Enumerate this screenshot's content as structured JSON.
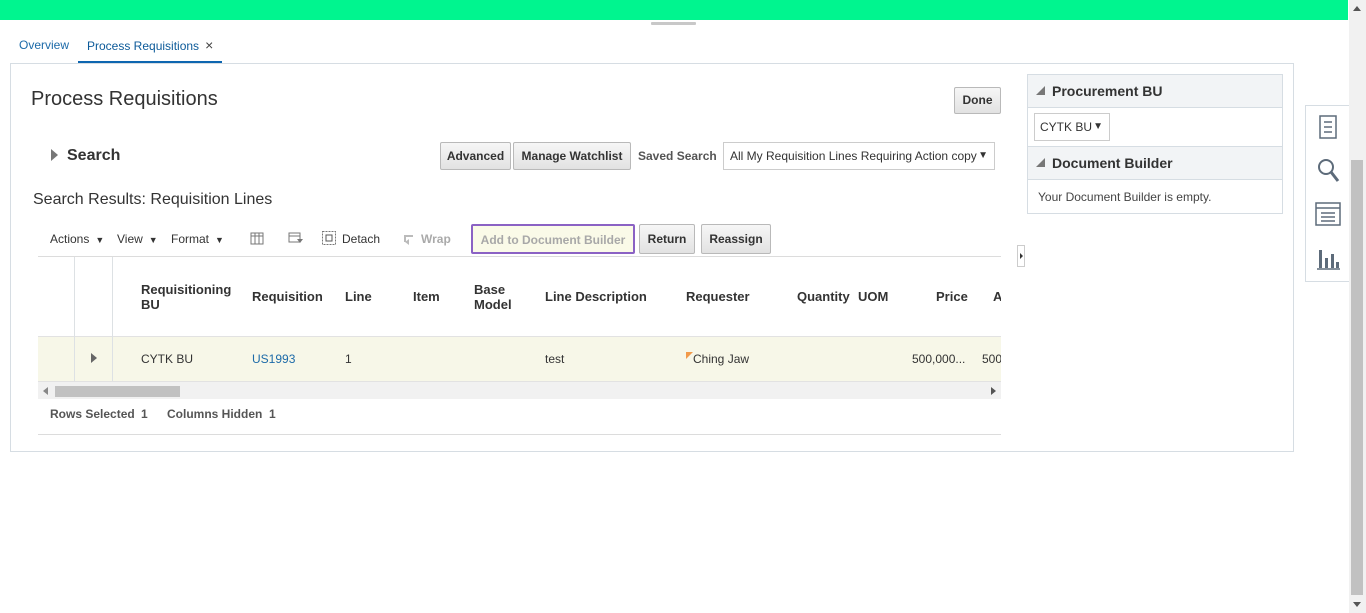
{
  "tabs": {
    "overview": "Overview",
    "active": "Process Requisitions",
    "close": "×"
  },
  "page": {
    "title": "Process Requisitions",
    "done_label": "Done"
  },
  "search": {
    "label": "Search",
    "advanced_label": "Advanced",
    "manage_watchlist_label": "Manage Watchlist",
    "saved_search_label": "Saved Search",
    "saved_search_value": "All My Requisition Lines Requiring Action copy"
  },
  "results": {
    "title": "Search Results: Requisition Lines",
    "toolbar": {
      "actions": "Actions",
      "view": "View",
      "format": "Format",
      "detach": "Detach",
      "wrap": "Wrap",
      "add_to_document_builder": "Add to Document Builder",
      "return": "Return",
      "reassign": "Reassign"
    },
    "columns": [
      "Requisitioning BU",
      "Requisition",
      "Line",
      "Item",
      "Base Model",
      "Line Description",
      "Requester",
      "Quantity",
      "UOM",
      "Price",
      "A"
    ],
    "rows": [
      {
        "requisitioning_bu": "CYTK BU",
        "requisition": "US1993",
        "line": "1",
        "line_description": "test",
        "requester": "Ching Jaw",
        "price": "500,000...",
        "amount": "500"
      }
    ],
    "status": {
      "rows_selected_label": "Rows Selected",
      "rows_selected_value": "1",
      "columns_hidden_label": "Columns Hidden",
      "columns_hidden_value": "1"
    }
  },
  "procurement_bu": {
    "title": "Procurement BU",
    "selected": "CYTK BU"
  },
  "document_builder": {
    "title": "Document Builder",
    "message": "Your Document Builder is empty."
  },
  "colors": {
    "top_bar": "#00f58f",
    "link": "#1c6aa8",
    "tab_active_underline": "#0d66b0",
    "focus_border": "#8b62c4"
  }
}
